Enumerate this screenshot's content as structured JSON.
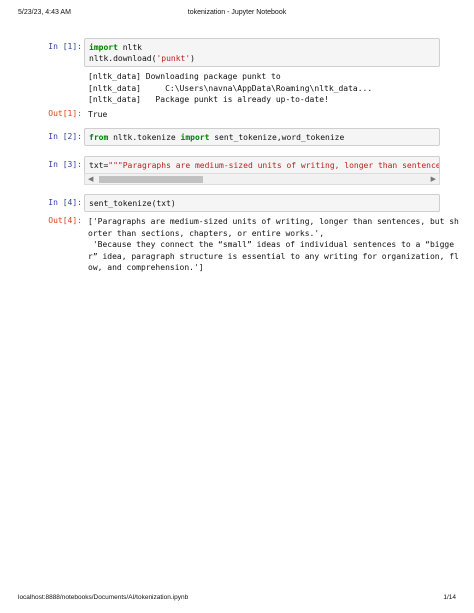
{
  "header": {
    "datetime": "5/23/23, 4:43 AM",
    "title": "tokenization - Jupyter Notebook"
  },
  "footer": {
    "url": "localhost:8888/notebooks/Documents/AI/tokenization.ipynb",
    "page": "1/14"
  },
  "cells": {
    "c1": {
      "prompt": "In [1]:",
      "kw1": "import",
      "mod1": " nltk",
      "line2a": "nltk.download(",
      "line2s": "'punkt'",
      "line2b": ")",
      "stream": "[nltk_data] Downloading package punkt to\n[nltk_data]     C:\\Users\\navna\\AppData\\Roaming\\nltk_data...\n[nltk_data]   Package punkt is already up-to-date!",
      "out_prompt": "Out[1]:",
      "out": "True"
    },
    "c2": {
      "prompt": "In [2]:",
      "kw1": "from",
      "mid": " nltk.tokenize ",
      "kw2": "import",
      "rest": " sent_tokenize,word_tokenize"
    },
    "c3": {
      "prompt": "In [3]:",
      "code_a": "txt=",
      "code_s": "\"\"\"Paragraphs are medium-sized units of writing, longer than sentences, bu"
    },
    "c4": {
      "prompt": "In [4]:",
      "code": "sent_tokenize(txt)",
      "out_prompt": "Out[4]:",
      "out": "['Paragraphs are medium-sized units of writing, longer than sentences, but sh\norter than sections, chapters, or entire works.',\n 'Because they connect the “small” ideas of individual sentences to a “bigge\nr” idea, paragraph structure is essential to any writing for organization, fl\now, and comprehension.']"
    }
  }
}
